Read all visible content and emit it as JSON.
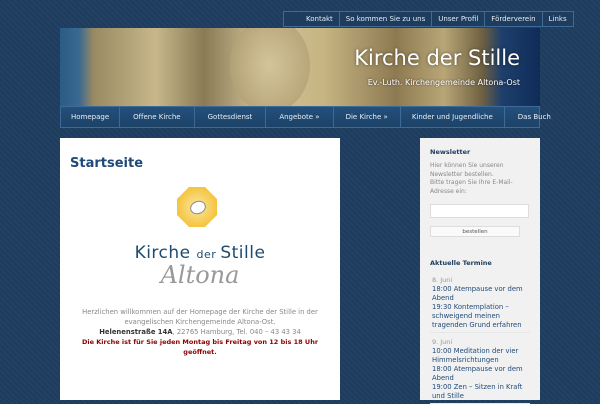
{
  "top_nav": [
    "Kontakt",
    "So kommen Sie zu uns",
    "Unser Profil",
    "Förderverein",
    "Links"
  ],
  "header": {
    "title": "Kirche der Stille",
    "subtitle": "Ev.-Luth. Kirchengemeinde Altona-Ost"
  },
  "main_nav": [
    "Homepage",
    "Offene Kirche",
    "Gottesdienst",
    "Angebote »",
    "Die Kirche »",
    "Kinder und Jugendliche",
    "Das Buch"
  ],
  "content": {
    "title": "Startseite",
    "logo": {
      "line1a": "Kirche ",
      "line1b": "der ",
      "line1c": "Stille",
      "line2": "Altona"
    },
    "intro": "Herzlichen willkommen auf der Homepage der Kirche der Stille in der evangelischen Kirchengemeinde Altona-Ost.",
    "street": "Helenenstraße 14A",
    "address_rest": ", 22765 Hamburg, Tel. 040 – 43 43 34",
    "opening": "Die Kirche ist für Sie jeden Montag bis Freitag von 12 bis 18 Uhr geöffnet."
  },
  "sidebar": {
    "newsletter": {
      "title": "Newsletter",
      "text1": "Hier können Sie unseren Newsletter bestellen.",
      "text2": "Bitte tragen Sie Ihre E-Mail-Adresse ein:",
      "email_value": "",
      "button": "bestellen"
    },
    "termine": {
      "title": "Aktuelle Termine",
      "days": [
        {
          "date": "8. Juni",
          "events": [
            "18:00 Atempause vor dem Abend",
            "19:30 Kontemplation – schweigend meinen tragenden Grund erfahren"
          ]
        },
        {
          "date": "9. Juni",
          "events": [
            "10:00 Meditation der vier Himmelsrichtungen",
            "18:00 Atempause vor dem Abend",
            "19:00 Zen – Sitzen in Kraft und Stille"
          ]
        }
      ]
    }
  }
}
